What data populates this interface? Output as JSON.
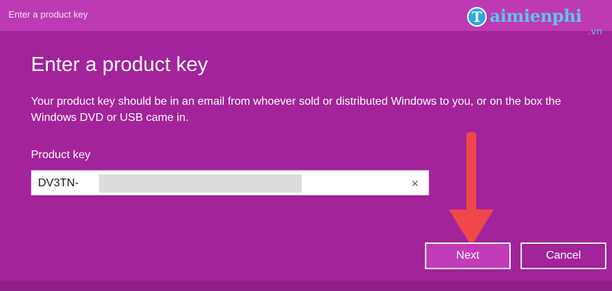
{
  "window": {
    "title": "Enter a product key"
  },
  "watermark": {
    "logo_letter": "T",
    "logo_text": "aimienphi",
    "logo_tld": ".vn"
  },
  "dialog": {
    "heading": "Enter a product key",
    "description": "Your product key should be in an email from whoever sold or distributed Windows to you, or on the box the Windows DVD or USB came in.",
    "field_label": "Product key",
    "field_value": "DV3TN-",
    "clear_glyph": "×",
    "next_label": "Next",
    "cancel_label": "Cancel"
  },
  "icons": {
    "clear": "close-icon",
    "annotation": "arrow-down-icon"
  },
  "colors": {
    "background": "#a3239a",
    "titlebar": "#bd3ab4",
    "accent_button": "#c23bb8",
    "annotation_arrow": "#f0484a"
  }
}
